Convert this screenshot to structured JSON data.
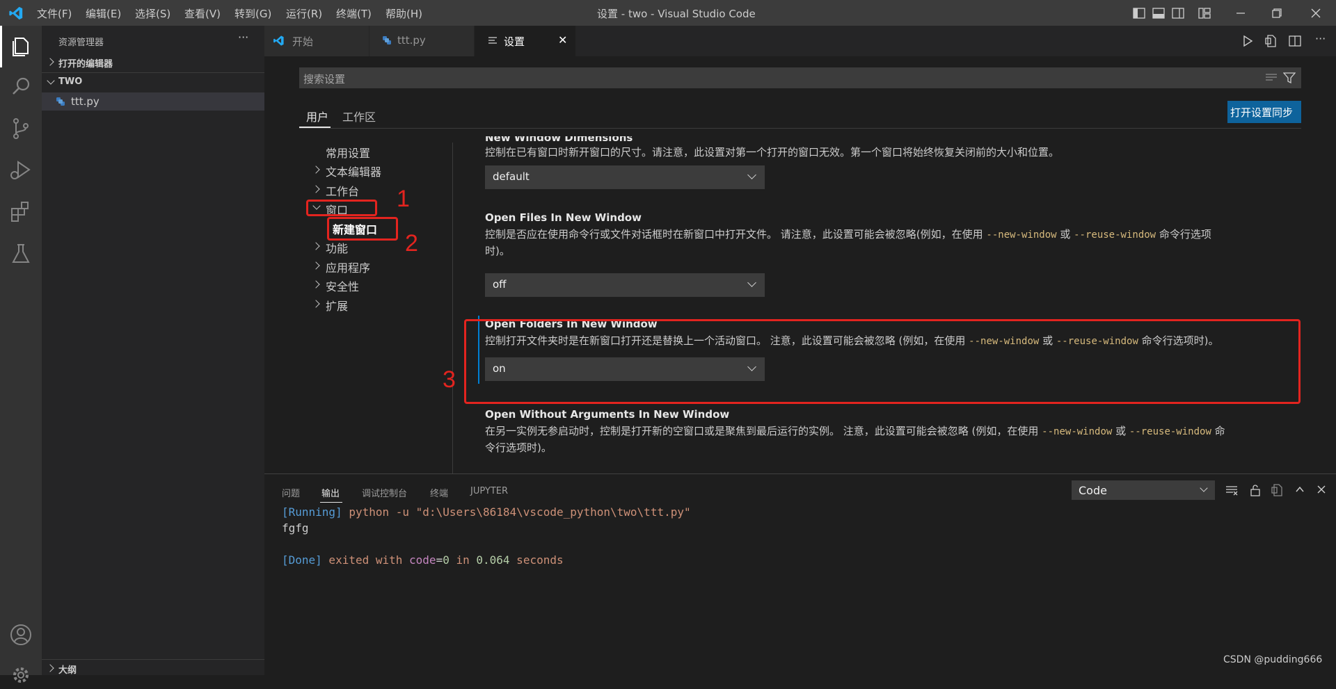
{
  "titlebar": {
    "menus": [
      "文件(F)",
      "编辑(E)",
      "选择(S)",
      "查看(V)",
      "转到(G)",
      "运行(R)",
      "终端(T)",
      "帮助(H)"
    ],
    "title": "设置 - two - Visual Studio Code"
  },
  "sidebar": {
    "header": "资源管理器",
    "more": "···",
    "open_editors": "打开的编辑器",
    "folder": "TWO",
    "file": "ttt.py",
    "outline": "大纲"
  },
  "tabs": [
    {
      "label": "开始"
    },
    {
      "label": "ttt.py"
    },
    {
      "label": "设置",
      "close": "✕"
    }
  ],
  "settings": {
    "search_placeholder": "搜索设置",
    "scope_tabs": [
      "用户",
      "工作区"
    ],
    "sync_button": "打开设置同步",
    "toc": [
      "常用设置",
      "文本编辑器",
      "工作台",
      "窗口",
      "新建窗口",
      "功能",
      "应用程序",
      "安全性",
      "扩展"
    ],
    "items": [
      {
        "title": "New Window Dimensions",
        "desc": "控制在已有窗口时新开窗口的尺寸。请注意，此设置对第一个打开的窗口无效。第一个窗口将始终恢复关闭前的大小和位置。",
        "value": "default"
      },
      {
        "title": "Open Files In New Window",
        "desc_a": "控制是否应在使用命令行或文件对话框时在新窗口中打开文件。 请注意，此设置可能会被忽略(例如，在使用 ",
        "code1": "--new-window",
        "desc_b": " 或 ",
        "code2": "--reuse-window",
        "desc_c": " 命令行选项",
        "desc_d": "时)。",
        "value": "off"
      },
      {
        "title": "Open Folders In New Window",
        "desc_a": "控制打开文件夹时是在新窗口打开还是替换上一个活动窗口。 注意，此设置可能会被忽略 (例如，在使用 ",
        "code1": "--new-window",
        "desc_b": " 或 ",
        "code2": "--reuse-window",
        "desc_c": " 命令行选项时)。",
        "value": "on"
      },
      {
        "title": "Open Without Arguments In New Window",
        "desc_a": "在另一实例无参启动时，控制是打开新的空窗口或是聚焦到最后运行的实例。 注意，此设置可能会被忽略 (例如，在使用 ",
        "code1": "--new-window",
        "desc_b": " 或 ",
        "code2": "--reuse-window",
        "desc_c": " 命",
        "desc_d": "令行选项时)。"
      }
    ]
  },
  "annotations": [
    "1",
    "2",
    "3"
  ],
  "panel": {
    "tabs": [
      "问题",
      "输出",
      "调试控制台",
      "终端",
      "JUPYTER"
    ],
    "channel": "Code",
    "lines": {
      "running_tag": "[Running]",
      "command": " python -u \"d:\\Users\\86184\\vscode_python\\two\\ttt.py\"",
      "output": "fgfg",
      "done_tag": "[Done]",
      "exited": " exited with ",
      "code_kw": "code",
      "eq": "=",
      "code_val": "0",
      "in_kw": " in ",
      "time": "0.064",
      "seconds": " seconds"
    }
  },
  "watermark": "CSDN @pudding666",
  "colors": {
    "accent": "#0e639c",
    "highlight_red": "#e3241f",
    "vscode_blue": "#23a9f2"
  }
}
